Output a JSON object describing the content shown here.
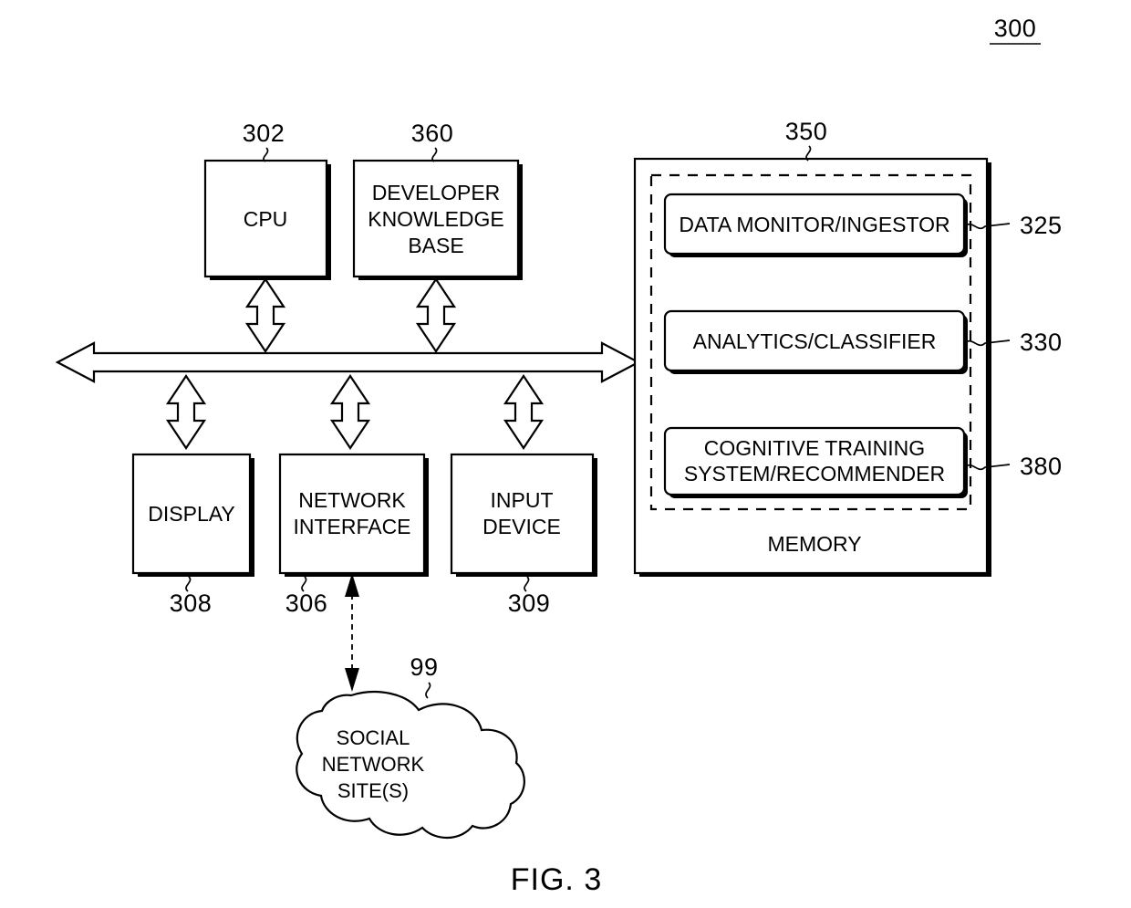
{
  "figure": {
    "system_ref": "300",
    "caption": "FIG. 3"
  },
  "blocks": {
    "cpu": {
      "label": "CPU",
      "ref": "302"
    },
    "developer_kb": {
      "line1": "DEVELOPER",
      "line2": "KNOWLEDGE",
      "line3": "BASE",
      "ref": "360"
    },
    "display": {
      "label": "DISPLAY",
      "ref": "308"
    },
    "network_interface": {
      "line1": "NETWORK",
      "line2": "INTERFACE",
      "ref": "306"
    },
    "input_device": {
      "line1": "INPUT",
      "line2": "DEVICE",
      "ref": "309"
    },
    "memory": {
      "label": "MEMORY",
      "ref": "350"
    },
    "data_monitor": {
      "label": "DATA MONITOR/INGESTOR",
      "ref": "325"
    },
    "analytics": {
      "label": "ANALYTICS/CLASSIFIER",
      "ref": "330"
    },
    "cognitive": {
      "line1": "COGNITIVE TRAINING",
      "line2": "SYSTEM/RECOMMENDER",
      "ref": "380"
    },
    "social_network": {
      "line1": "SOCIAL",
      "line2": "NETWORK",
      "line3": "SITE(S)",
      "ref": "99"
    }
  },
  "connectors": {
    "bus_name": "system-bus",
    "cpu_bus": "bidirectional",
    "kb_bus": "bidirectional",
    "display_bus": "bidirectional",
    "nic_bus": "bidirectional",
    "input_bus": "bidirectional",
    "nic_cloud": "bidirectional-dashed"
  },
  "colors": {
    "line": "#000000",
    "fill": "#ffffff",
    "background": "#ffffff"
  }
}
